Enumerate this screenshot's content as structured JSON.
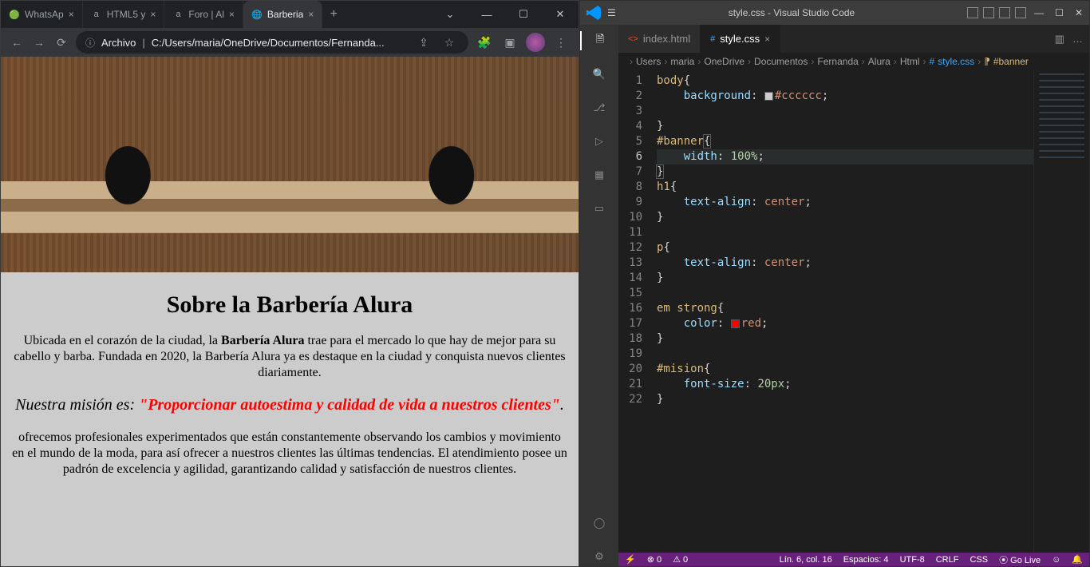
{
  "chrome": {
    "tabs": [
      {
        "label": "WhatsAp",
        "favicon": "🟢"
      },
      {
        "label": "HTML5 y",
        "favicon": "a"
      },
      {
        "label": "Foro | Al",
        "favicon": "a"
      },
      {
        "label": "Barberia",
        "favicon": "🌐",
        "active": true
      }
    ],
    "nav": {
      "back": "←",
      "fwd": "→",
      "reload": "⟳"
    },
    "address": {
      "info_icon": "ⓘ",
      "prefix": "Archivo",
      "url": "C:/Users/maria/OneDrive/Documentos/Fernanda..."
    },
    "toolbar_icons": {
      "share": "⇪",
      "star": "☆",
      "ext": "🧩",
      "panel": "▣"
    },
    "page": {
      "h1": "Sobre la Barbería Alura",
      "p1a": "Ubicada en el corazón de la ciudad, la ",
      "p1b": "Barbería Alura",
      "p1c": " trae para el mercado lo que hay de mejor para su cabello y barba. Fundada en 2020, la Barbería Alura ya es destaque en la ciudad y conquista nuevos clientes diariamente.",
      "mis_a": "Nuestra misión es: ",
      "mis_b": "\"Proporcionar autoestima y calidad de vida a nuestros clientes\"",
      "mis_c": ".",
      "p3": "ofrecemos profesionales experimentados que están constantemente observando los cambios y movimiento en el mundo de la moda, para así ofrecer a nuestros clientes las últimas tendencias. El atendimiento posee un padrón de excelencia y agilidad, garantizando calidad y satisfacción de nuestros clientes."
    }
  },
  "vscode": {
    "title": "style.css - Visual Studio Code",
    "tabs": [
      {
        "label": "index.html",
        "icon": "<>"
      },
      {
        "label": "style.css",
        "icon": "#",
        "active": true
      }
    ],
    "breadcrumbs": [
      "Users",
      "maria",
      "OneDrive",
      "Documentos",
      "Fernanda",
      "Alura",
      "Html"
    ],
    "breadcrumb_file": "style.css",
    "breadcrumb_symbol": "#banner",
    "code": {
      "l1": "body",
      "l2p": "background",
      "l2v": "#cccccc",
      "l5": "#banner",
      "l6p": "width",
      "l6v": "100%",
      "l8": "h1",
      "l9p": "text-align",
      "l9v": "center",
      "l12": "p",
      "l13p": "text-align",
      "l13v": "center",
      "l16": "em strong",
      "l17p": "color",
      "l17v": "red",
      "l20": "#mision",
      "l21p": "font-size",
      "l21v": "20px"
    },
    "status": {
      "remote": "⚡",
      "err": "⊗ 0",
      "warn": "⚠ 0",
      "pos": "Lín. 6, col. 16",
      "spaces": "Espacios: 4",
      "enc": "UTF-8",
      "eol": "CRLF",
      "lang": "CSS",
      "golive": "⦿ Go Live",
      "bell": "🔔"
    }
  }
}
